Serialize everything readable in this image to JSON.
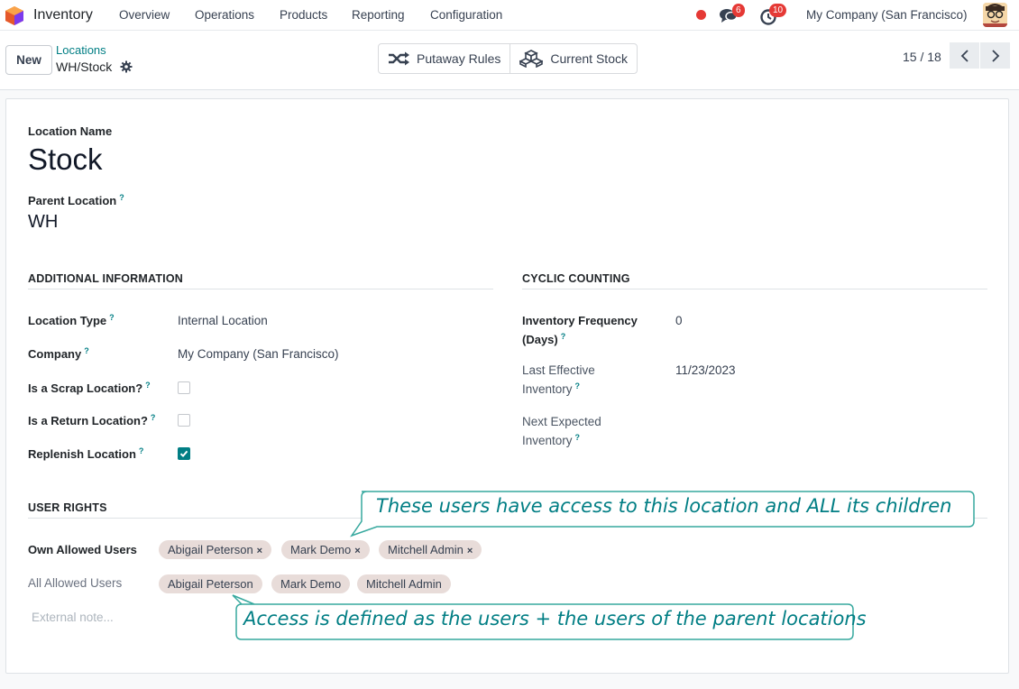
{
  "navbar": {
    "app_name": "Inventory",
    "menu": [
      "Overview",
      "Operations",
      "Products",
      "Reporting",
      "Configuration"
    ],
    "messages_count": "6",
    "activities_count": "10",
    "company": "My Company (San Francisco)"
  },
  "control": {
    "new_label": "New",
    "breadcrumb_parent": "Locations",
    "breadcrumb_current": "WH/Stock",
    "putaway_label": "Putaway Rules",
    "current_stock_label": "Current Stock",
    "pager": "15 / 18"
  },
  "form": {
    "location_name_label": "Location Name",
    "location_name": "Stock",
    "parent_location_label": "Parent Location",
    "parent_location": "WH",
    "additional_info_title": "ADDITIONAL INFORMATION",
    "location_type_label": "Location Type",
    "location_type": "Internal Location",
    "company_label": "Company",
    "company": "My Company (San Francisco)",
    "scrap_label": "Is a Scrap Location?",
    "scrap_checked": false,
    "return_label": "Is a Return Location?",
    "return_checked": false,
    "replenish_label": "Replenish Location",
    "replenish_checked": true,
    "cyclic_title": "CYCLIC COUNTING",
    "freq_label_1": "Inventory Frequency",
    "freq_label_2": "(Days)",
    "freq_value": "0",
    "last_label_1": "Last Effective",
    "last_label_2": "Inventory",
    "last_value": "11/23/2023",
    "next_label_1": "Next Expected",
    "next_label_2": "Inventory",
    "user_rights_title": "USER RIGHTS",
    "own_users_label": "Own Allowed Users",
    "own_users": [
      "Abigail Peterson",
      "Mark Demo",
      "Mitchell Admin"
    ],
    "all_users_label": "All Allowed Users",
    "all_users": [
      "Abigail Peterson",
      "Mark Demo",
      "Mitchell Admin"
    ],
    "external_note_placeholder": "External note..."
  },
  "callouts": {
    "top": "These users have access to this location and ALL its children",
    "bottom": "Access is defined as the users + the users of the parent locations"
  },
  "colors": {
    "accent": "#017e84",
    "badge": "#e53935",
    "tag_bg": "#e8dcd9"
  }
}
